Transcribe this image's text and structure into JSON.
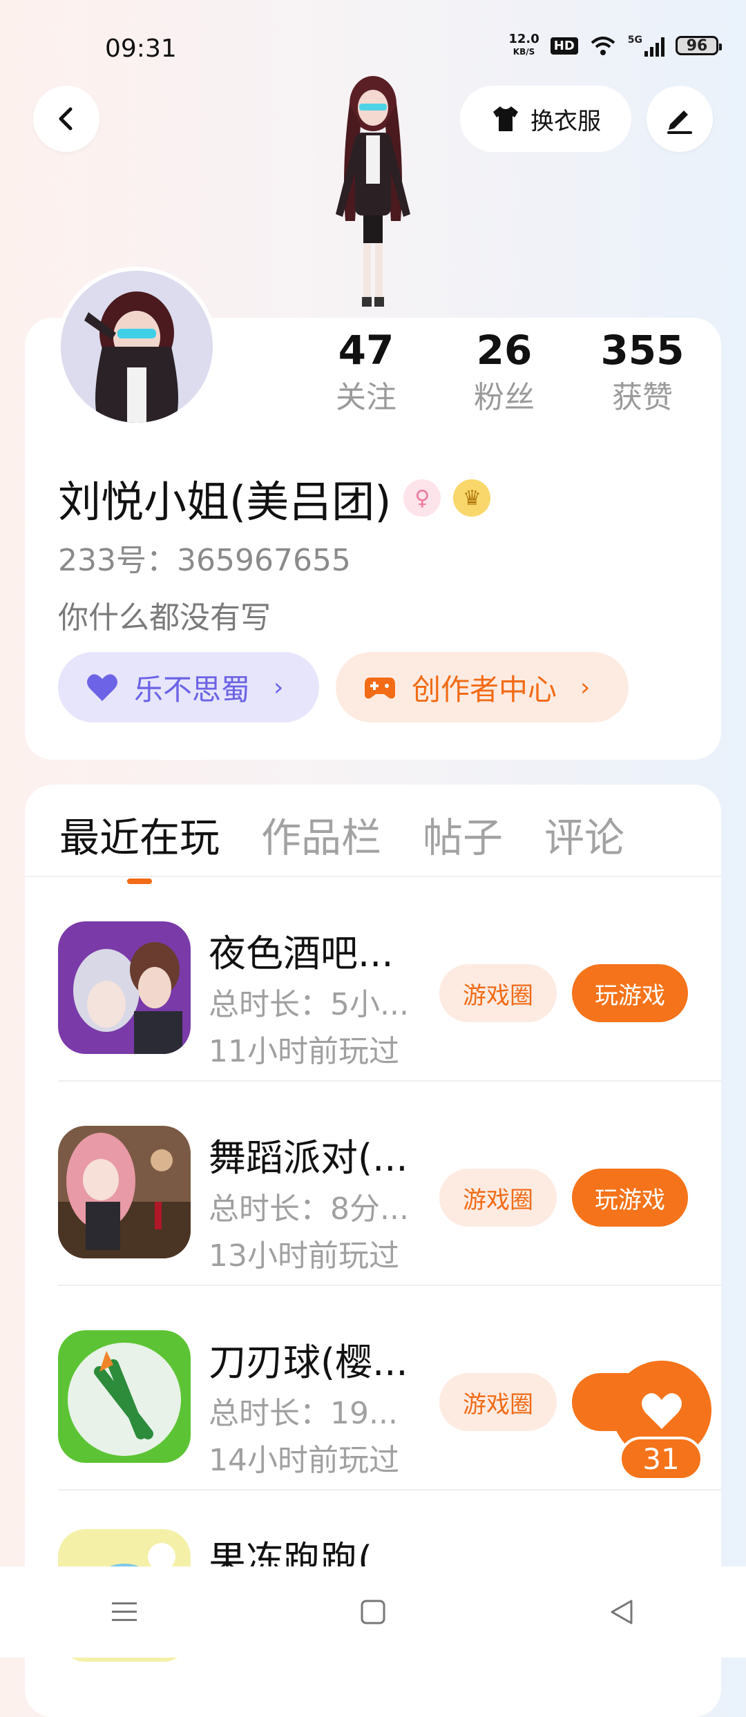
{
  "status_bar": {
    "time": "09:31",
    "net_speed_value": "12.0",
    "net_speed_unit": "KB/S",
    "hd_label": "HD",
    "network_label": "5G",
    "battery": "96"
  },
  "header": {
    "outfit_button": "换衣服"
  },
  "profile": {
    "stats": [
      {
        "value": "47",
        "label": "关注"
      },
      {
        "value": "26",
        "label": "粉丝"
      },
      {
        "value": "355",
        "label": "获赞"
      }
    ],
    "name": "刘悦小姐(美吕团)",
    "uid": "233号：365967655",
    "bio": "你什么都没有写",
    "group_pill": "乐不思蜀",
    "creator_pill": "创作者中心"
  },
  "tabs": [
    "最近在玩",
    "作品栏",
    "帖子",
    "评论"
  ],
  "games": [
    {
      "title": "夜色酒吧...",
      "duration": "总时长：5小...",
      "last_played": "11小时前玩过",
      "circle_btn": "游戏圈",
      "play_btn": "玩游戏"
    },
    {
      "title": "舞蹈派对(...",
      "duration": "总时长：8分...",
      "last_played": "13小时前玩过",
      "circle_btn": "游戏圈",
      "play_btn": "玩游戏"
    },
    {
      "title": "刀刃球(樱...",
      "duration": "总时长：19...",
      "last_played": "14小时前玩过",
      "circle_btn": "游戏圈",
      "play_btn": "玩"
    },
    {
      "title": "果冻跑跑(..."
    }
  ],
  "like": {
    "count": "31"
  },
  "colors": {
    "accent": "#f5731a",
    "purple": "#6c63e6",
    "muted": "#a0a0a0"
  }
}
